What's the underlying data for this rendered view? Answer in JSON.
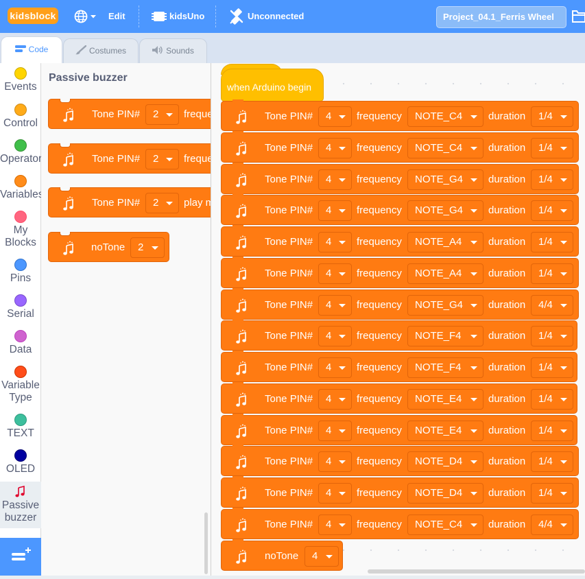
{
  "menubar": {
    "logo": "kidsblock",
    "edit": "Edit",
    "board": "kidsUno",
    "connection": "Unconnected",
    "project_title": "Project_04.1_Ferris Wheel"
  },
  "tabs": [
    "Code",
    "Costumes",
    "Sounds"
  ],
  "categories": [
    {
      "label": "Events",
      "color": "#ffd500"
    },
    {
      "label": "Control",
      "color": "#ffab19"
    },
    {
      "label": "Operators",
      "color": "#40bf4a"
    },
    {
      "label": "Variables",
      "color": "#ff8c1a"
    },
    {
      "label": "My Blocks",
      "color": "#ff6680"
    },
    {
      "label": "Pins",
      "color": "#4c97ff"
    },
    {
      "label": "Serial",
      "color": "#9966ff"
    },
    {
      "label": "Data",
      "color": "#cf63cf"
    },
    {
      "label": "Variable Type",
      "color": "#ff4d1a"
    },
    {
      "label": "TEXT",
      "color": "#3dbf9d"
    },
    {
      "label": "OLED",
      "color": "#0000a0"
    },
    {
      "label": "Passive buzzer",
      "color": "#e0002b"
    }
  ],
  "flyout": {
    "title": "Passive buzzer",
    "blocks": [
      {
        "label": "Tone PIN#",
        "pin": "2",
        "tail": "freque"
      },
      {
        "label": "Tone PIN#",
        "pin": "2",
        "tail": "freque"
      },
      {
        "label": "Tone PIN#",
        "pin": "2",
        "tail": "play m"
      },
      {
        "label": "noTone",
        "pin": "2"
      }
    ]
  },
  "script": {
    "hat": "when Arduino begin",
    "tone_label": "Tone PIN#",
    "freq_label": "frequency",
    "dur_label": "duration",
    "notone_label": "noTone",
    "notone_pin": "4",
    "rows": [
      {
        "pin": "4",
        "note": "NOTE_C4",
        "dur": "1/4"
      },
      {
        "pin": "4",
        "note": "NOTE_C4",
        "dur": "1/4"
      },
      {
        "pin": "4",
        "note": "NOTE_G4",
        "dur": "1/4"
      },
      {
        "pin": "4",
        "note": "NOTE_G4",
        "dur": "1/4"
      },
      {
        "pin": "4",
        "note": "NOTE_A4",
        "dur": "1/4"
      },
      {
        "pin": "4",
        "note": "NOTE_A4",
        "dur": "1/4"
      },
      {
        "pin": "4",
        "note": "NOTE_G4",
        "dur": "4/4"
      },
      {
        "pin": "4",
        "note": "NOTE_F4",
        "dur": "1/4"
      },
      {
        "pin": "4",
        "note": "NOTE_F4",
        "dur": "1/4"
      },
      {
        "pin": "4",
        "note": "NOTE_E4",
        "dur": "1/4"
      },
      {
        "pin": "4",
        "note": "NOTE_E4",
        "dur": "1/4"
      },
      {
        "pin": "4",
        "note": "NOTE_D4",
        "dur": "1/4"
      },
      {
        "pin": "4",
        "note": "NOTE_D4",
        "dur": "1/4"
      },
      {
        "pin": "4",
        "note": "NOTE_C4",
        "dur": "4/4"
      }
    ]
  }
}
